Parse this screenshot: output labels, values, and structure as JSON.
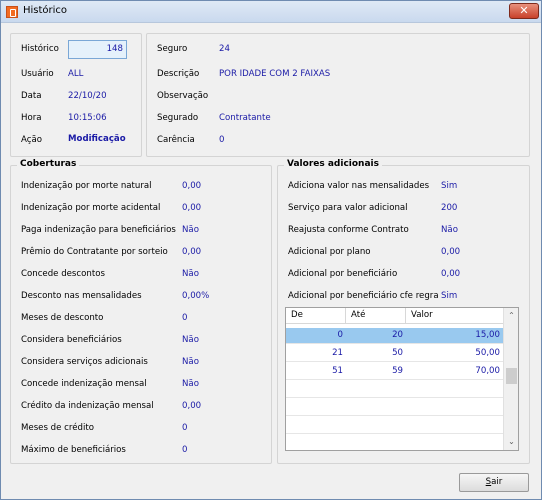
{
  "window": {
    "title": "Histórico",
    "close_label": "✕"
  },
  "header_left": {
    "historico_label": "Histórico",
    "historico_value": "148",
    "usuario_label": "Usuário",
    "usuario_value": "ALL",
    "data_label": "Data",
    "data_value": "22/10/20",
    "hora_label": "Hora",
    "hora_value": "10:15:06",
    "acao_label": "Ação",
    "acao_value": "Modificação"
  },
  "header_right": {
    "seguro_label": "Seguro",
    "seguro_value": "24",
    "descricao_label": "Descrição",
    "descricao_value": "POR IDADE COM 2 FAIXAS",
    "observacao_label": "Observação",
    "segurado_label": "Segurado",
    "segurado_value": "Contratante",
    "carencia_label": "Carência",
    "carencia_value": "0"
  },
  "coberturas": {
    "title": "Coberturas",
    "rows": [
      {
        "label": "Indenização por morte natural",
        "value": "0,00"
      },
      {
        "label": "Indenização por morte acidental",
        "value": "0,00"
      },
      {
        "label": "Paga indenização para beneficiários",
        "value": "Não"
      },
      {
        "label": "Prêmio do Contratante por sorteio",
        "value": "0,00"
      },
      {
        "label": "Concede descontos",
        "value": "Não"
      },
      {
        "label": "Desconto nas mensalidades",
        "value": "0,00%"
      },
      {
        "label": "Meses de desconto",
        "value": "0"
      },
      {
        "label": "Considera beneficiários",
        "value": "Não"
      },
      {
        "label": "Considera serviços adicionais",
        "value": "Não"
      },
      {
        "label": "Concede indenização mensal",
        "value": "Não"
      },
      {
        "label": "Crédito da indenização mensal",
        "value": "0,00"
      },
      {
        "label": "Meses de crédito",
        "value": "0"
      },
      {
        "label": "Máximo de beneficiários",
        "value": "0"
      }
    ]
  },
  "valores_adicionais": {
    "title": "Valores adicionais",
    "rows": [
      {
        "label": "Adiciona valor nas mensalidades",
        "value": "Sim"
      },
      {
        "label": "Serviço para valor adicional",
        "value": "200"
      },
      {
        "label": "Reajusta conforme Contrato",
        "value": "Não"
      },
      {
        "label": "Adicional por plano",
        "value": "0,00"
      },
      {
        "label": "Adicional por beneficiário",
        "value": "0,00"
      },
      {
        "label": "Adicional por beneficiário cfe regra",
        "value": "Sim"
      }
    ],
    "grid": {
      "headers": [
        "De",
        "Até",
        "Valor"
      ],
      "rows": [
        {
          "de": "0",
          "ate": "20",
          "valor": "15,00"
        },
        {
          "de": "21",
          "ate": "50",
          "valor": "50,00"
        },
        {
          "de": "51",
          "ate": "59",
          "valor": "70,00"
        }
      ],
      "scroll_up": "⌃",
      "scroll_down": "⌄"
    }
  },
  "footer": {
    "sair_prefix": "",
    "sair_underline": "S",
    "sair_rest": "air"
  }
}
